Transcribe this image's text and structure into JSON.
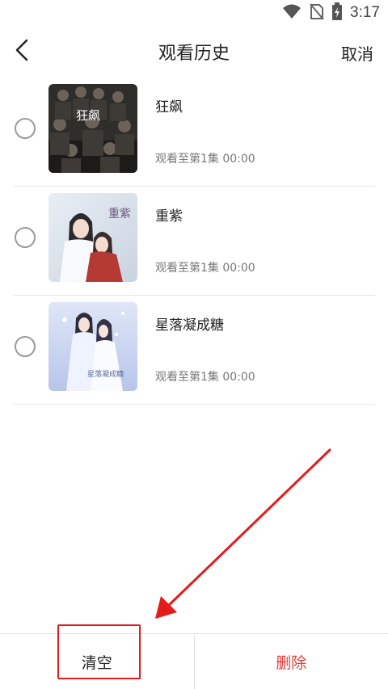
{
  "status_bar": {
    "time": "3:17",
    "icons": [
      "wifi-icon",
      "no-sim-icon",
      "battery-charging-icon"
    ]
  },
  "header": {
    "back_icon": "chevron-left-icon",
    "title": "观看历史",
    "cancel_label": "取消"
  },
  "history": {
    "items": [
      {
        "title": "狂飙",
        "progress": "观看至第1集  00:00",
        "selected": false,
        "poster_text": "狂飙"
      },
      {
        "title": "重紫",
        "progress": "观看至第1集  00:00",
        "selected": false,
        "poster_text": "重紫"
      },
      {
        "title": "星落凝成糖",
        "progress": "观看至第1集  00:00",
        "selected": false,
        "poster_text": "星落凝成糖"
      }
    ]
  },
  "bottom_bar": {
    "clear_label": "清空",
    "delete_label": "删除"
  },
  "colors": {
    "accent_red": "#e53935",
    "annotation_red": "#e31b1b",
    "divider": "#e6e6e6"
  }
}
